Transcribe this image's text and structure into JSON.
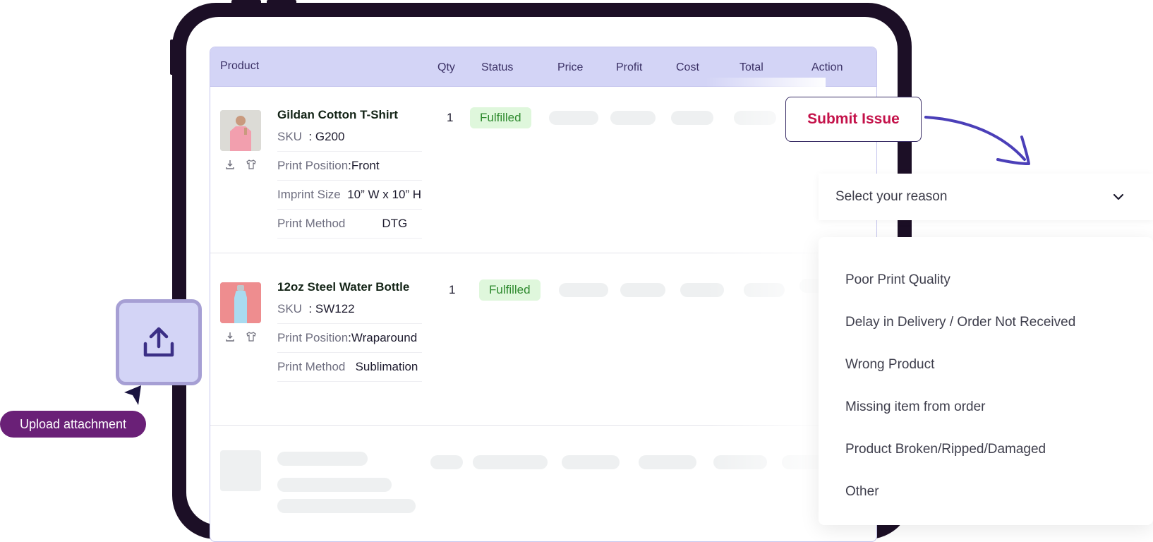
{
  "table": {
    "headers": [
      "Product",
      "Qty",
      "Status",
      "Price",
      "Profit",
      "Cost",
      "Total",
      "Action"
    ],
    "rows": [
      {
        "product_name": "Gildan Cotton T-Shirt",
        "sku_label": "SKU",
        "sku": "G200",
        "attributes": [
          {
            "label": "Print Position",
            "value": "Front"
          },
          {
            "label": "Imprint Size",
            "value": "10” W x 10” H"
          },
          {
            "label": "Print Method",
            "value": "DTG"
          }
        ],
        "qty": "1",
        "status": "Fulfilled"
      },
      {
        "product_name": "12oz Steel Water Bottle",
        "sku_label": "SKU",
        "sku": "SW122",
        "attributes": [
          {
            "label": "Print Position",
            "value": "Wraparound"
          },
          {
            "label": "Print Method",
            "value": "Sublimation"
          }
        ],
        "qty": "1",
        "status": "Fulfilled"
      }
    ]
  },
  "issue": {
    "submit_label": "Submit Issue",
    "select_placeholder": "Select your reason",
    "options": [
      "Poor Print Quality",
      "Delay in Delivery / Order Not Received",
      "Wrong Product",
      "Missing item from order",
      "Product Broken/Ripped/Damaged",
      "Other"
    ]
  },
  "upload": {
    "label": "Upload attachment"
  },
  "colors": {
    "header_bg": "#d3d4f6",
    "fulfilled_bg": "#dff7dc",
    "fulfilled_text": "#2e8a2e",
    "submit_text": "#c4124a",
    "upload_label_bg": "#6a2077",
    "tablet_frame": "#1c0f26"
  }
}
